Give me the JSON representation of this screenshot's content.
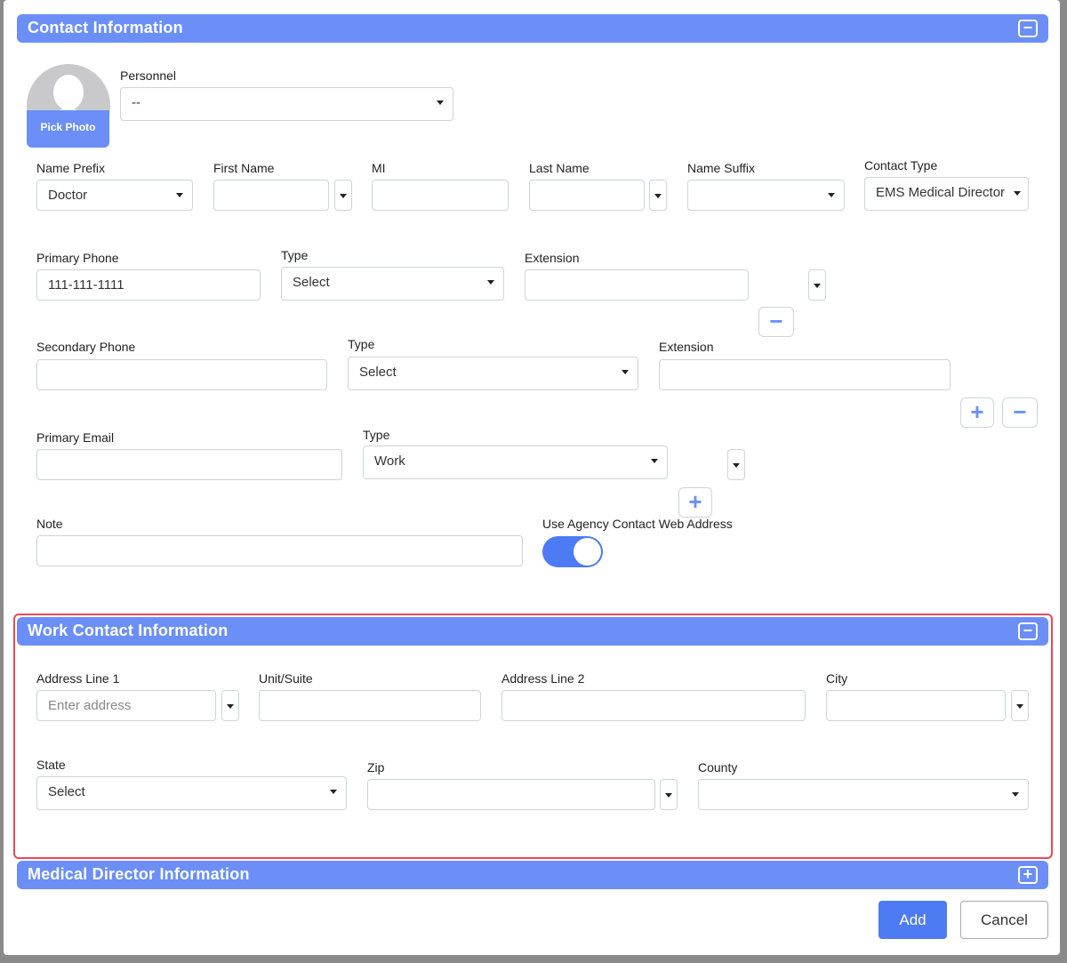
{
  "contact": {
    "title": "Contact Information",
    "toggle": "−",
    "pick_photo": "Pick Photo",
    "personnel": {
      "label": "Personnel",
      "value": "--"
    },
    "name_prefix": {
      "label": "Name Prefix",
      "value": "Doctor"
    },
    "first_name": {
      "label": "First Name",
      "value": ""
    },
    "mi": {
      "label": "MI",
      "value": ""
    },
    "last_name": {
      "label": "Last Name",
      "value": ""
    },
    "name_suffix": {
      "label": "Name Suffix",
      "value": ""
    },
    "contact_type": {
      "label": "Contact Type",
      "value": "EMS Medical Director"
    },
    "primary_phone": {
      "label": "Primary Phone",
      "value": "111-111-1111",
      "type_label": "Type",
      "type_value": "Select",
      "ext_label": "Extension"
    },
    "secondary_phone": {
      "label": "Secondary Phone",
      "value": "",
      "type_label": "Type",
      "type_value": "Select",
      "ext_label": "Extension"
    },
    "primary_email": {
      "label": "Primary Email",
      "value": "",
      "type_label": "Type",
      "type_value": "Work"
    },
    "note": {
      "label": "Note",
      "value": ""
    },
    "agency_web": {
      "label": "Use Agency Contact Web Address",
      "enabled": true
    }
  },
  "work": {
    "title": "Work Contact Information",
    "toggle": "−",
    "address1": {
      "label": "Address Line 1",
      "placeholder": "Enter address"
    },
    "unit": {
      "label": "Unit/Suite",
      "value": ""
    },
    "address2": {
      "label": "Address Line 2",
      "value": ""
    },
    "city": {
      "label": "City",
      "value": ""
    },
    "state": {
      "label": "State",
      "value": "Select"
    },
    "zip": {
      "label": "Zip",
      "value": ""
    },
    "county": {
      "label": "County",
      "value": ""
    }
  },
  "medical": {
    "title": "Medical Director Information",
    "toggle": "+"
  },
  "buttons": {
    "add": "Add",
    "cancel": "Cancel",
    "plus": "+",
    "minus": "−"
  },
  "colors": {
    "header": "#6b8ff7",
    "primary": "#4d7bf3",
    "highlight": "#e64a58"
  }
}
